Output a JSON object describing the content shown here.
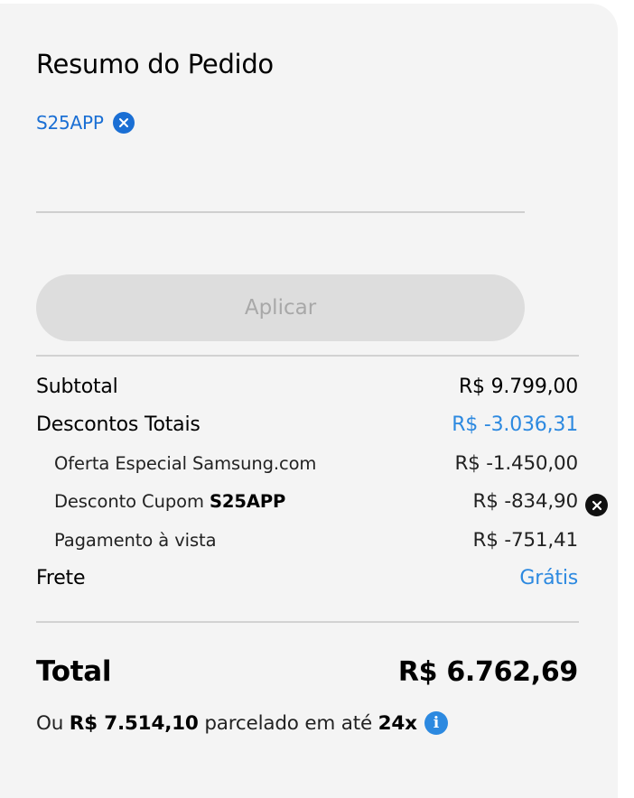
{
  "order_summary": {
    "title": "Resumo do Pedido",
    "applied_coupon": "S25APP",
    "coupon_input": {
      "value": "",
      "placeholder": ""
    },
    "apply_button_label": "Aplicar",
    "subtotal": {
      "label": "Subtotal",
      "value": "R$ 9.799,00"
    },
    "total_discounts": {
      "label": "Descontos Totais",
      "value": "R$ -3.036,31"
    },
    "discounts": [
      {
        "label": "Oferta Especial Samsung.com",
        "value": "R$ -1.450,00"
      },
      {
        "label_prefix": "Desconto Cupom",
        "code": "S25APP",
        "value": "R$ -834,90"
      },
      {
        "label": "Pagamento à vista",
        "value": "R$ -751,41"
      }
    ],
    "shipping": {
      "label": "Frete",
      "value": "Grátis"
    },
    "total": {
      "label": "Total",
      "value": "R$ 6.762,69"
    },
    "installment": {
      "prefix": "Ou",
      "amount": "R$ 7.514,10",
      "middle": "parcelado em até",
      "count": "24x"
    }
  },
  "icons": {
    "remove_chip": "close-circle-icon",
    "remove_coupon": "close-circle-icon",
    "info": "info-icon"
  },
  "colors": {
    "accent_blue": "#2c89e0",
    "chip_blue": "#1a6fd4",
    "card_bg": "#f4f4f4",
    "button_disabled": "#dddddd"
  }
}
